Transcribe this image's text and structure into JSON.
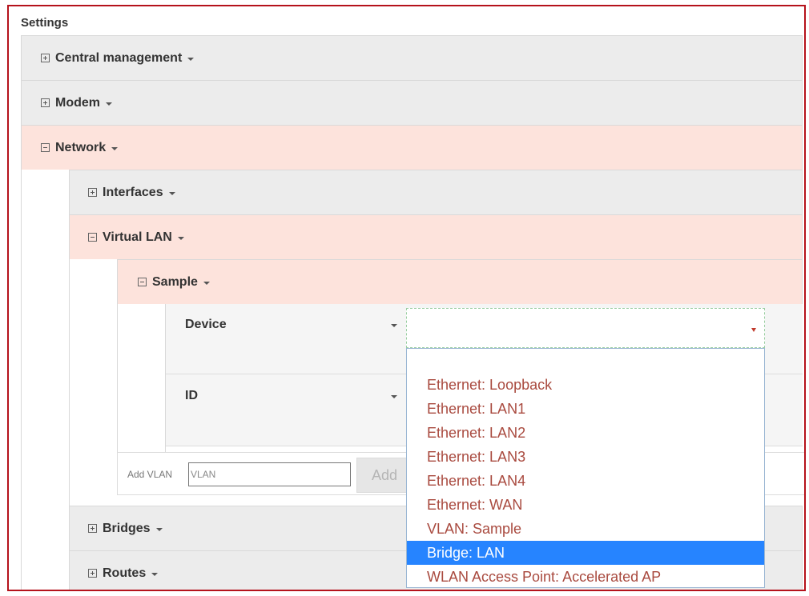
{
  "settings": {
    "title": "Settings"
  },
  "sections": {
    "central_management": "Central management",
    "modem": "Modem",
    "network": "Network",
    "interfaces": "Interfaces",
    "virtual_lan": "Virtual LAN",
    "sample": "Sample",
    "bridges": "Bridges",
    "routes": "Routes"
  },
  "fields": {
    "device_label": "Device",
    "id_label": "ID",
    "device_value": ""
  },
  "dropdown": {
    "options": [
      "Ethernet: Loopback",
      "Ethernet: LAN1",
      "Ethernet: LAN2",
      "Ethernet: LAN3",
      "Ethernet: LAN4",
      "Ethernet: WAN",
      "VLAN: Sample",
      "Bridge: LAN",
      "WLAN Access Point: Accelerated AP"
    ],
    "selected": "Bridge: LAN"
  },
  "add_vlan": {
    "label": "Add VLAN",
    "placeholder": "VLAN",
    "button_label": "Add"
  },
  "colors": {
    "frame_border": "#b5121b",
    "collapsed_row": "#ececec",
    "expanded_row": "#fde3dc",
    "option_text": "#a94a3f",
    "option_selected_bg": "#2684ff"
  }
}
